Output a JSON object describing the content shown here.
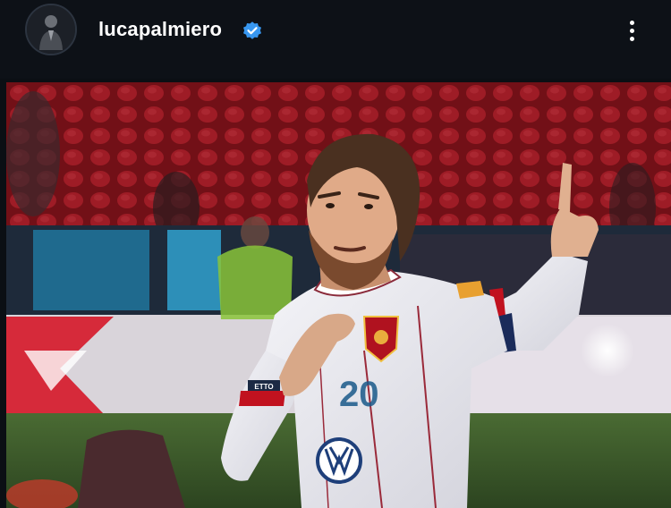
{
  "post": {
    "username": "lucapalmiero",
    "verified": true,
    "more_icon": "more-vertical-icon"
  },
  "photo": {
    "jersey_number": "20",
    "sponsor_text": "ETTO"
  },
  "colors": {
    "verified_blue": "#3897f0",
    "seat_red": "#b0202a",
    "jersey_white": "#eeeef2",
    "pitch_green": "#3e5a2a"
  }
}
